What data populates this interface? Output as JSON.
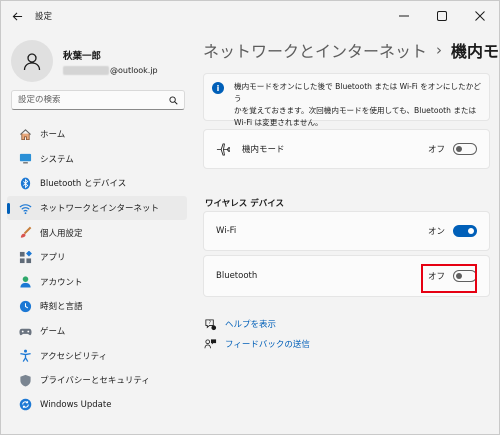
{
  "window": {
    "title": "設定",
    "icons": {
      "back": "back-arrow-icon",
      "minimize": "minimize-icon",
      "maximize": "maximize-icon",
      "close": "close-icon"
    }
  },
  "profile": {
    "name": "秋葉一郎",
    "email_domain": "@outlook.jp"
  },
  "search": {
    "placeholder": "設定の検索",
    "icon": "search-icon"
  },
  "nav": {
    "items": [
      {
        "label": "ホーム",
        "icon": "home-icon"
      },
      {
        "label": "システム",
        "icon": "system-icon"
      },
      {
        "label": "Bluetooth とデバイス",
        "icon": "bluetooth-icon"
      },
      {
        "label": "ネットワークとインターネット",
        "icon": "wifi-icon"
      },
      {
        "label": "個人用設定",
        "icon": "brush-icon"
      },
      {
        "label": "アプリ",
        "icon": "apps-icon"
      },
      {
        "label": "アカウント",
        "icon": "account-icon"
      },
      {
        "label": "時刻と言語",
        "icon": "time-language-icon"
      },
      {
        "label": "ゲーム",
        "icon": "gamepad-icon"
      },
      {
        "label": "アクセシビリティ",
        "icon": "accessibility-icon"
      },
      {
        "label": "プライバシーとセキュリティ",
        "icon": "shield-icon"
      },
      {
        "label": "Windows Update",
        "icon": "update-icon"
      }
    ],
    "active_index": 3
  },
  "breadcrumb": {
    "parent": "ネットワークとインターネット",
    "separator": "›",
    "current": "機内モード"
  },
  "info": {
    "line1": "機内モードをオンにした後で Bluetooth または Wi-Fi をオンにしたかどう",
    "line2": "かを覚えておきます。次回機内モードを使用しても、Bluetooth または",
    "line3": "Wi-Fi は変更されません。",
    "icon": "info-icon"
  },
  "airplane": {
    "label": "機内モード",
    "state": "オフ",
    "on": false,
    "icon": "airplane-icon"
  },
  "wireless": {
    "title": "ワイヤレス デバイス",
    "wifi": {
      "label": "Wi-Fi",
      "state": "オン",
      "on": true
    },
    "bluetooth": {
      "label": "Bluetooth",
      "state": "オフ",
      "on": false
    }
  },
  "links": {
    "help": {
      "label": "ヘルプを表示",
      "icon": "help-icon"
    },
    "feedback": {
      "label": "フィードバックの送信",
      "icon": "feedback-icon"
    }
  },
  "colors": {
    "accent": "#005fb8",
    "highlight": "#e60012",
    "background": "#f3f3f3"
  }
}
